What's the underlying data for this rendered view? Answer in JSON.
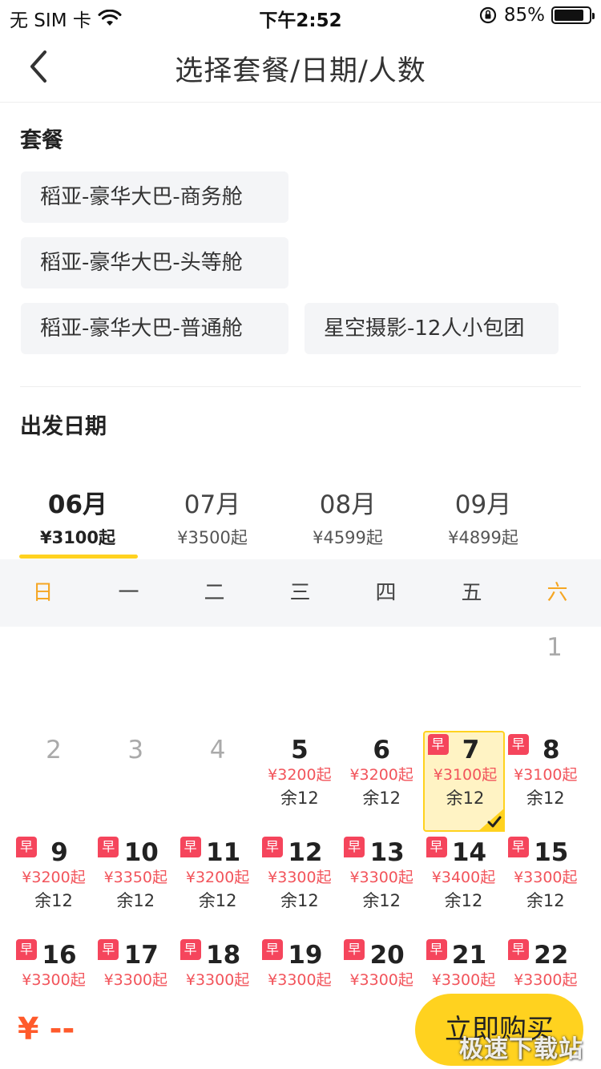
{
  "status_bar": {
    "carrier": "无 SIM 卡",
    "time": "下午2:52",
    "battery": "85%",
    "battery_level": 0.85
  },
  "nav": {
    "title": "选择套餐/日期/人数"
  },
  "packages": {
    "title": "套餐",
    "items": [
      "稻亚-豪华大巴-商务舱",
      "稻亚-豪华大巴-头等舱",
      "稻亚-豪华大巴-普通舱",
      "星空摄影-12人小包团"
    ]
  },
  "departure": {
    "title": "出发日期",
    "months": [
      {
        "name": "06月",
        "price": "¥3100起"
      },
      {
        "name": "07月",
        "price": "¥3500起"
      },
      {
        "name": "08月",
        "price": "¥4599起"
      },
      {
        "name": "09月",
        "price": "¥4899起"
      }
    ],
    "active_month": 0
  },
  "calendar": {
    "weekdays": [
      "日",
      "一",
      "二",
      "三",
      "四",
      "五",
      "六"
    ],
    "badge_label": "早",
    "days": [
      {
        "day": "1",
        "disabled": true
      },
      {
        "day": "2",
        "disabled": true
      },
      {
        "day": "3",
        "disabled": true
      },
      {
        "day": "4",
        "disabled": true
      },
      {
        "day": "5",
        "price": "¥3200起",
        "stock": "余12"
      },
      {
        "day": "6",
        "price": "¥3200起",
        "stock": "余12"
      },
      {
        "day": "7",
        "price": "¥3100起",
        "stock": "余12",
        "badge": true,
        "selected": true
      },
      {
        "day": "8",
        "price": "¥3100起",
        "stock": "余12",
        "badge": true
      },
      {
        "day": "9",
        "price": "¥3200起",
        "stock": "余12",
        "badge": true
      },
      {
        "day": "10",
        "price": "¥3350起",
        "stock": "余12",
        "badge": true
      },
      {
        "day": "11",
        "price": "¥3200起",
        "stock": "余12",
        "badge": true
      },
      {
        "day": "12",
        "price": "¥3300起",
        "stock": "余12",
        "badge": true
      },
      {
        "day": "13",
        "price": "¥3300起",
        "stock": "余12",
        "badge": true
      },
      {
        "day": "14",
        "price": "¥3400起",
        "stock": "余12",
        "badge": true
      },
      {
        "day": "15",
        "price": "¥3300起",
        "stock": "余12",
        "badge": true
      },
      {
        "day": "16",
        "price": "¥3300起",
        "badge": true
      },
      {
        "day": "17",
        "price": "¥3300起",
        "badge": true
      },
      {
        "day": "18",
        "price": "¥3300起",
        "badge": true
      },
      {
        "day": "19",
        "price": "¥3300起",
        "badge": true
      },
      {
        "day": "20",
        "price": "¥3300起",
        "badge": true
      },
      {
        "day": "21",
        "price": "¥3300起",
        "badge": true
      },
      {
        "day": "22",
        "price": "¥3300起",
        "badge": true
      }
    ]
  },
  "footer": {
    "price": "¥ --",
    "buy_label": "立即购买"
  },
  "watermark": "极速下载站",
  "colors": {
    "accent": "#ffd21f",
    "price_red": "#f2545b",
    "badge": "#f5455c",
    "weekend": "#f5a623",
    "total_price": "#ff5a2b"
  }
}
